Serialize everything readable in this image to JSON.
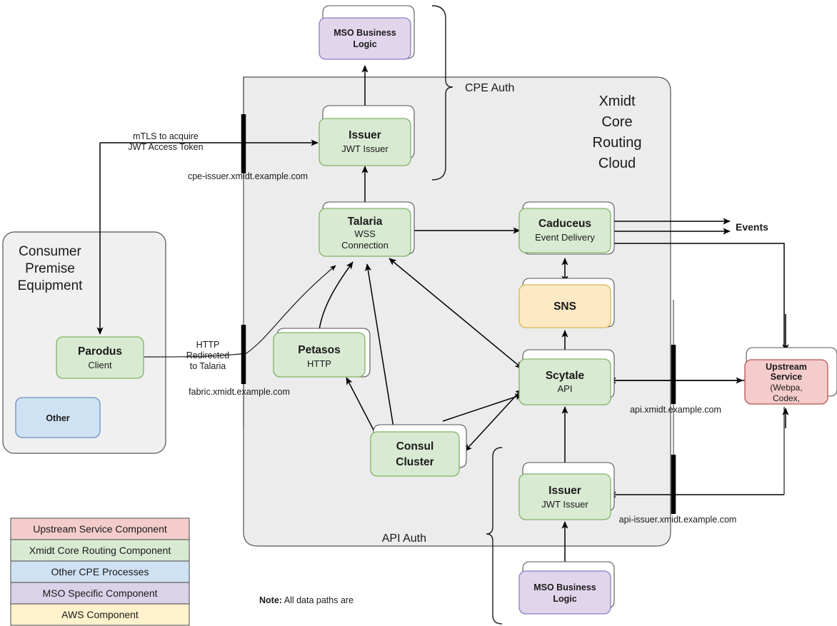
{
  "diagram": {
    "title": "Xmidt Core Routing Cloud architecture",
    "cloud": {
      "title_lines": [
        "Xmidt",
        "Core",
        "Routing",
        "Cloud"
      ]
    },
    "cpe_group": {
      "title_lines": [
        "Consumer",
        "Premise",
        "Equipment"
      ]
    },
    "nodes": [
      {
        "id": "mso-top",
        "title": "MSO Business",
        "title2": "Logic",
        "sub": "",
        "type": "mso"
      },
      {
        "id": "issuer-top",
        "title": "Issuer",
        "title2": "",
        "sub": "JWT Issuer",
        "type": "xmidt"
      },
      {
        "id": "talaria",
        "title": "Talaria",
        "title2": "",
        "sub": "WSS",
        "sub2": "Connection",
        "type": "xmidt"
      },
      {
        "id": "caduceus",
        "title": "Caduceus",
        "title2": "",
        "sub": "Event Delivery",
        "type": "xmidt"
      },
      {
        "id": "sns",
        "title": "SNS",
        "title2": "",
        "sub": "",
        "type": "aws"
      },
      {
        "id": "petasos",
        "title": "Petasos",
        "title2": "",
        "sub": "HTTP",
        "type": "xmidt"
      },
      {
        "id": "scytale",
        "title": "Scytale",
        "title2": "",
        "sub": "API",
        "type": "xmidt"
      },
      {
        "id": "consul",
        "title": "Consul",
        "title2": "Cluster",
        "sub": "",
        "type": "xmidt"
      },
      {
        "id": "issuer-bottom",
        "title": "Issuer",
        "title2": "",
        "sub": "JWT Issuer",
        "type": "xmidt"
      },
      {
        "id": "mso-bottom",
        "title": "MSO Business",
        "title2": "Logic",
        "sub": "",
        "type": "mso"
      },
      {
        "id": "parodus",
        "title": "Parodus",
        "title2": "",
        "sub": "Client",
        "type": "xmidt"
      },
      {
        "id": "other",
        "title": "Other",
        "title2": "",
        "sub": "",
        "type": "other"
      },
      {
        "id": "upstream",
        "title": "Upstream",
        "title2": "Service",
        "sub": "(Webpa,",
        "sub2": "Codex,",
        "type": "upstream"
      }
    ],
    "edge_labels": [
      {
        "id": "mtls",
        "lines": [
          "mTLS to acquire",
          "JWT Access Token"
        ]
      },
      {
        "id": "http",
        "lines": [
          "HTTP",
          "Redirected",
          "to Talaria"
        ]
      }
    ],
    "dns_labels": [
      {
        "id": "cpe-issuer",
        "text": "cpe-issuer.xmidt.example.com"
      },
      {
        "id": "fabric",
        "text": "fabric.xmidt.example.com"
      },
      {
        "id": "api",
        "text": "api.xmidt.example.com"
      },
      {
        "id": "api-issuer",
        "text": "api-issuer.xmidt.example.com"
      }
    ],
    "braces": [
      {
        "id": "cpe-auth",
        "label": "CPE Auth"
      },
      {
        "id": "api-auth",
        "label": "API Auth"
      }
    ],
    "events_label": "Events",
    "note": {
      "bold": "Note:",
      "text": " All data paths are"
    }
  },
  "legend": {
    "items": [
      {
        "label": "Upstream Service Component",
        "color": "#f4cccc",
        "stroke": "#cc8c8c"
      },
      {
        "label": "Xmidt Core Routing Component",
        "color": "#d9ead3",
        "stroke": "#93c47d"
      },
      {
        "label": "Other CPE Processes",
        "color": "#cfe2f3",
        "stroke": "#6fa8dc"
      },
      {
        "label": "MSO Specific Component",
        "color": "#d9d2e9",
        "stroke": "#a193cc"
      },
      {
        "label": "AWS Component",
        "color": "#fff2cc",
        "stroke": "#d6b656"
      }
    ]
  },
  "colors": {
    "upstream": "#f4cccc",
    "xmidt": "#d9ead3",
    "other": "#cfe2f3",
    "mso": "#e1d5ec",
    "aws": "#fde9c4",
    "cloud_bg": "#ececec",
    "cpe_bg": "#f0f0f0",
    "stroke_dark": "#1a1a1a"
  }
}
